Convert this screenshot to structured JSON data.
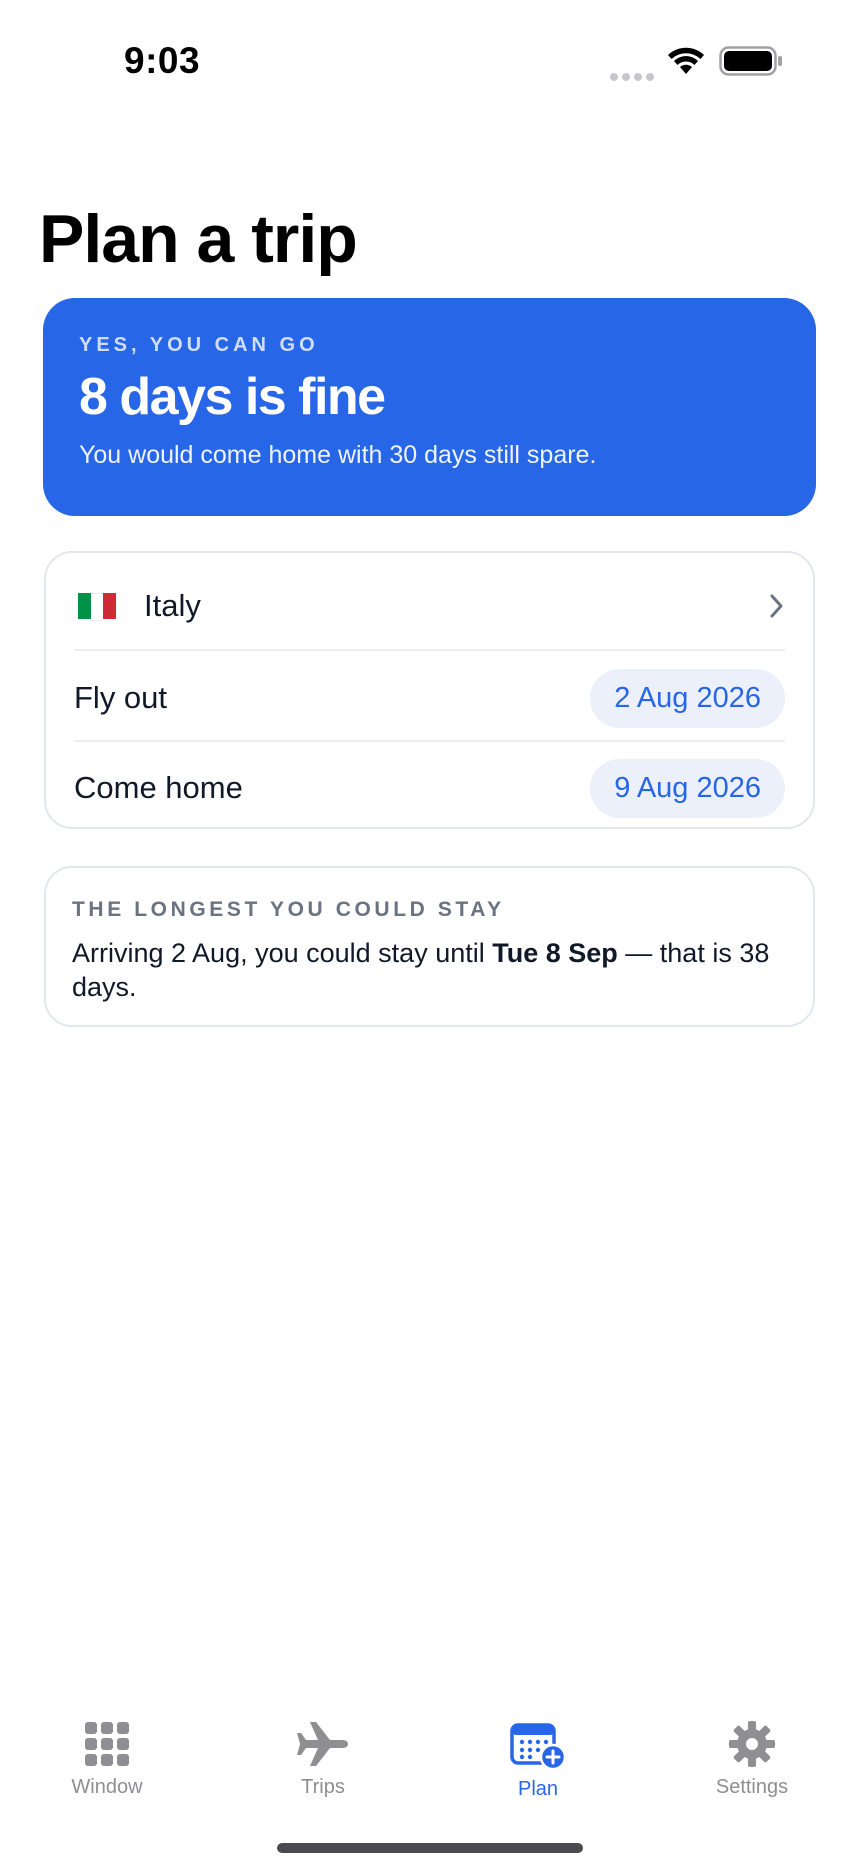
{
  "status_bar": {
    "time": "9:03"
  },
  "header": {
    "title": "Plan a trip"
  },
  "verdict": {
    "kicker": "YES, YOU CAN GO",
    "headline": "8 days is fine",
    "subtitle": "You would come home with 30 days still spare."
  },
  "form": {
    "country": {
      "flag_icon": "italy-flag-icon",
      "name": "Italy"
    },
    "fly_out": {
      "label": "Fly out",
      "value": "2 Aug 2026"
    },
    "come_home": {
      "label": "Come home",
      "value": "9 Aug 2026"
    }
  },
  "longest_stay": {
    "kicker": "THE LONGEST YOU COULD STAY",
    "prefix": "Arriving 2 Aug, you could stay until ",
    "highlight": "Tue 8 Sep",
    "suffix": " — that is 38 days."
  },
  "tabs": [
    {
      "label": "Window",
      "icon": "grid-icon",
      "active": false
    },
    {
      "label": "Trips",
      "icon": "airplane-icon",
      "active": false
    },
    {
      "label": "Plan",
      "icon": "calendar-plus-icon",
      "active": true
    },
    {
      "label": "Settings",
      "icon": "gear-icon",
      "active": false
    }
  ],
  "colors": {
    "accent": "#2766e6",
    "pill_background": "#ebf0fa",
    "tab_inactive": "#8e8e93",
    "flag_green": "#009246",
    "flag_white": "#ffffff",
    "flag_red": "#ce2b37"
  }
}
